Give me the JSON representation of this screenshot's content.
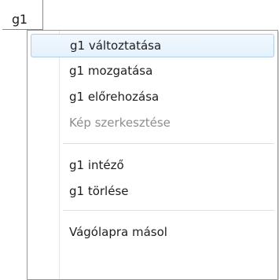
{
  "anchor": {
    "label": "g1"
  },
  "menu": {
    "items": [
      {
        "label": "g1 változtatása",
        "enabled": true,
        "highlighted": true
      },
      {
        "label": "g1 mozgatása",
        "enabled": true,
        "highlighted": false
      },
      {
        "label": "g1 előrehozása",
        "enabled": true,
        "highlighted": false
      },
      {
        "label": "Kép szerkesztése",
        "enabled": false,
        "highlighted": false
      },
      {
        "label": "g1 intéző",
        "enabled": true,
        "highlighted": false
      },
      {
        "label": "g1 törlése",
        "enabled": true,
        "highlighted": false
      },
      {
        "label": "Vágólapra másol",
        "enabled": true,
        "highlighted": false
      }
    ]
  },
  "colors": {
    "highlight_border": "#aecdea",
    "highlight_fill": "#e4f1fc",
    "disabled_text": "#8d8d8d",
    "text": "#1e1e1e"
  }
}
